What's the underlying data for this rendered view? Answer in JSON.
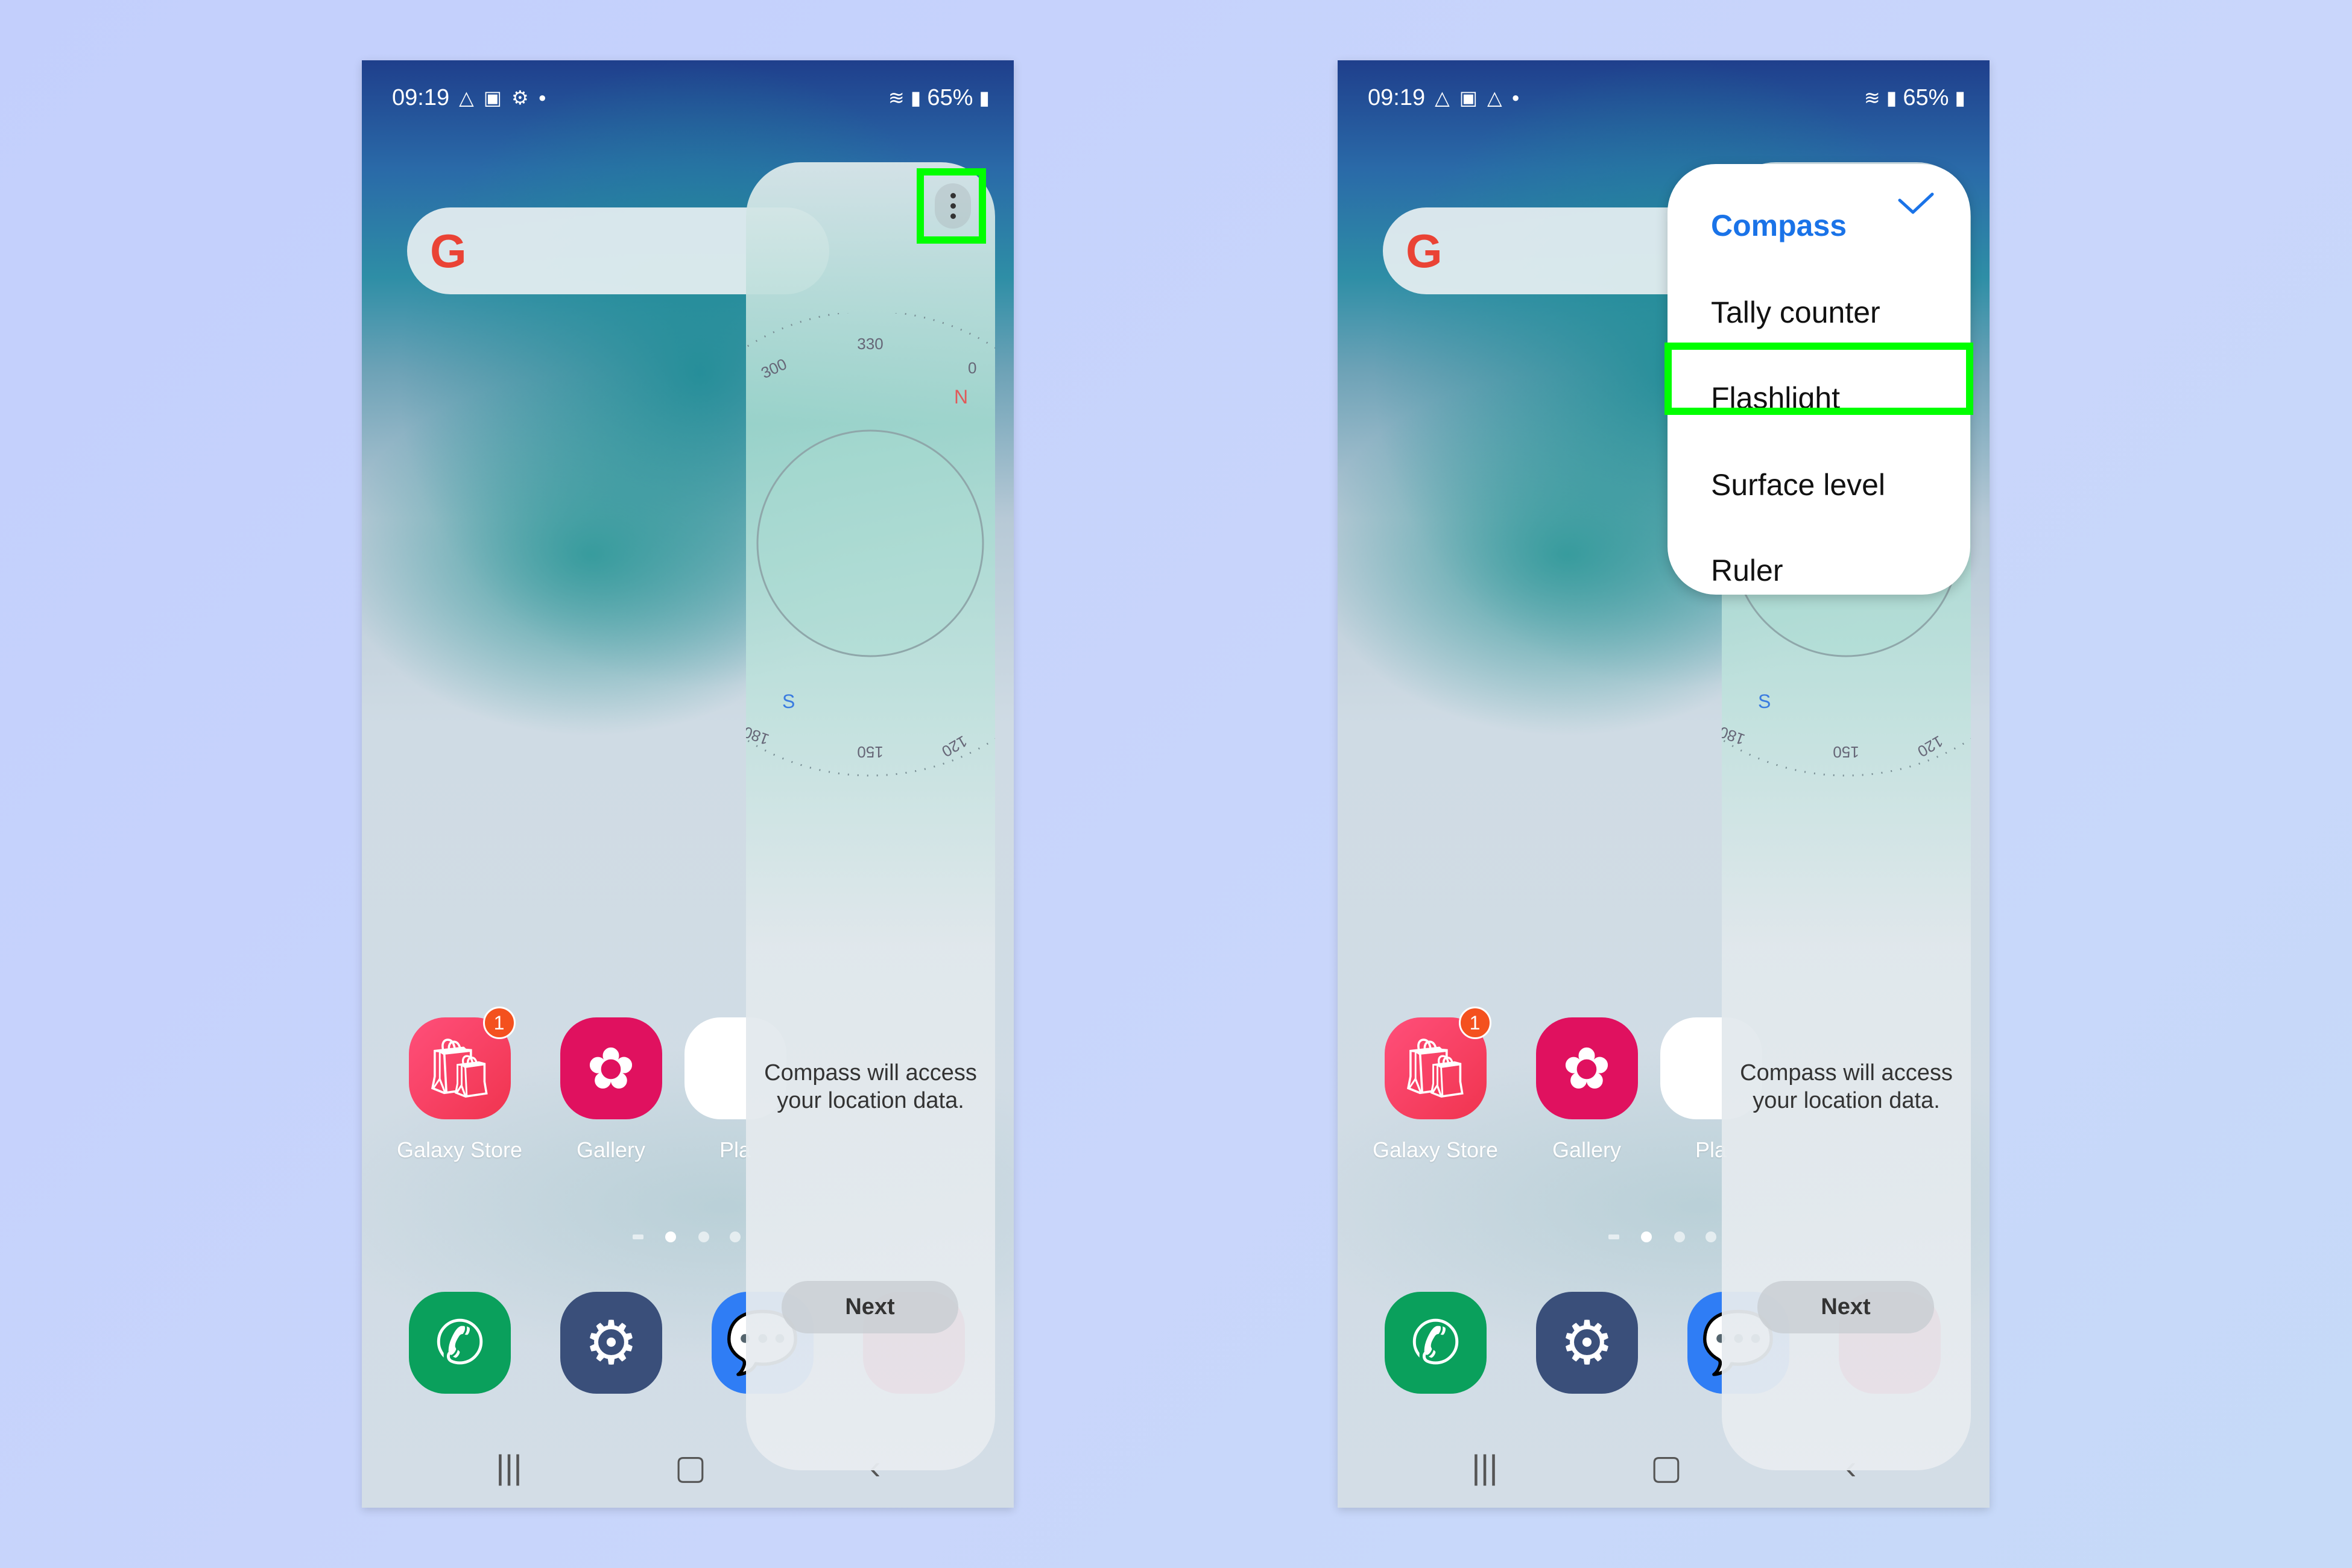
{
  "status_bar": {
    "time": "09:19",
    "battery": "65%",
    "icons_left": [
      "navigation-icon",
      "gallery-icon",
      "settings-icon",
      "dot-icon"
    ],
    "icons_right": [
      "wifi-icon",
      "signal-icon",
      "battery-icon"
    ]
  },
  "home": {
    "apps": [
      {
        "label": "Galaxy Store",
        "badge": "1",
        "color": "#f0344f"
      },
      {
        "label": "Gallery",
        "color": "#e0115f"
      },
      {
        "label": "Pla"
      }
    ],
    "dock": [
      {
        "name": "phone",
        "color": "#0aa05c"
      },
      {
        "name": "settings",
        "color": "#3a4f7a"
      },
      {
        "name": "messages",
        "color": "#2f7df5"
      },
      {
        "name": "camera",
        "color": "#e5194f"
      }
    ]
  },
  "compass": {
    "ticks": [
      "330",
      "300",
      "0",
      "N",
      "S",
      "180",
      "150",
      "120"
    ],
    "message": "Compass will access your location data.",
    "next_label": "Next"
  },
  "menu": {
    "items": [
      {
        "label": "Compass",
        "selected": true
      },
      {
        "label": "Tally counter"
      },
      {
        "label": "Flashlight",
        "highlighted": true
      },
      {
        "label": "Surface level"
      },
      {
        "label": "Ruler"
      }
    ]
  },
  "colors": {
    "highlight": "#00ff00",
    "accent": "#1a73e8"
  }
}
